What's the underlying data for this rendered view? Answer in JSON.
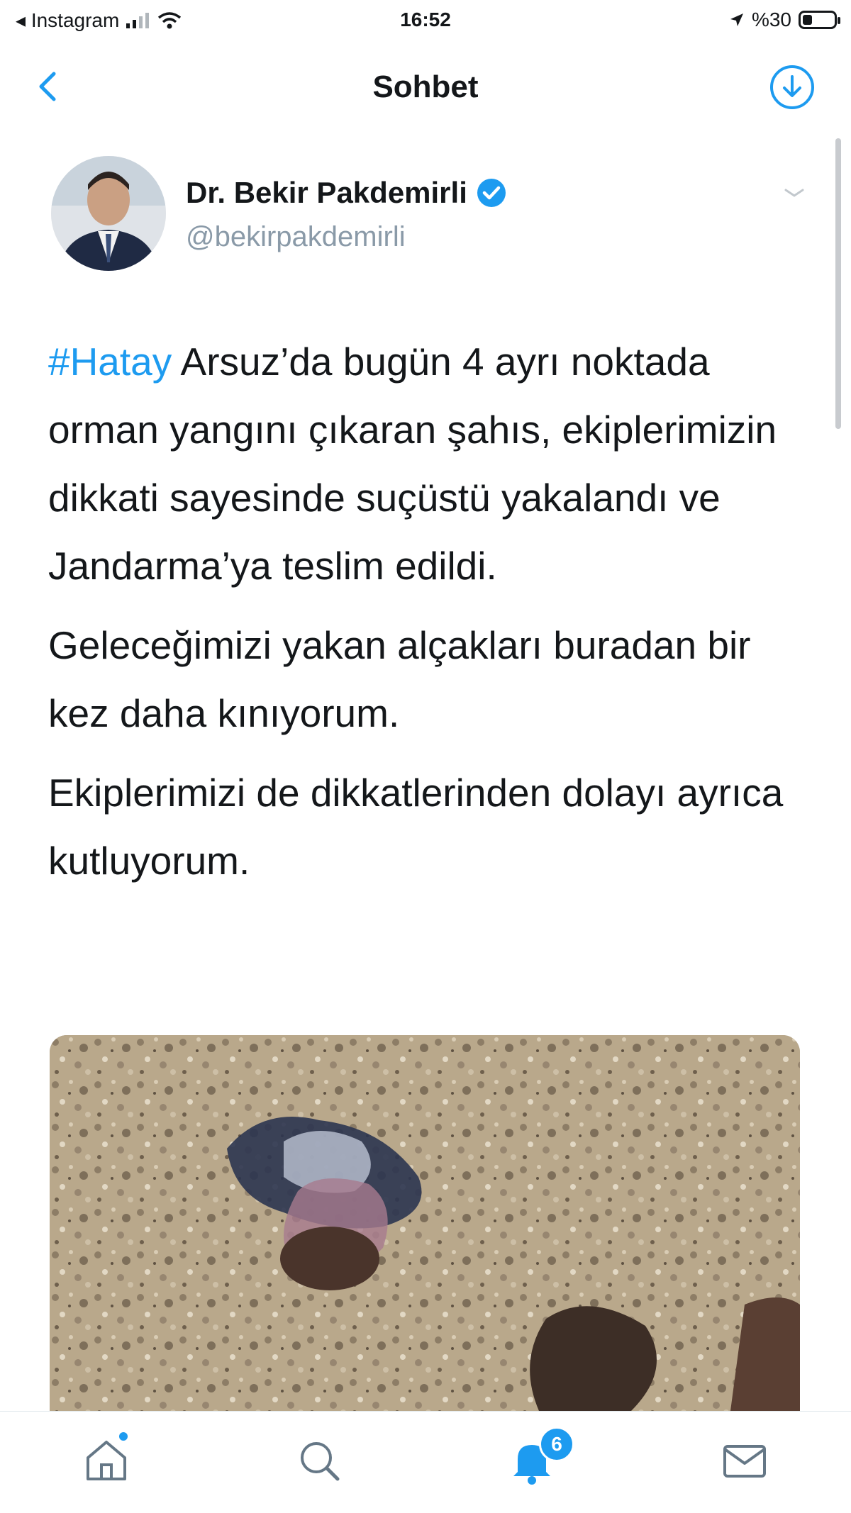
{
  "status_bar": {
    "carrier": "◂ Instagram",
    "time": "16:52",
    "battery_percent": "%30",
    "battery_level": 0.3
  },
  "nav": {
    "title": "Sohbet"
  },
  "tweet": {
    "author_name": "Dr. Bekir Pakdemirli",
    "author_handle": "@bekirpakdemirli",
    "hashtag": "#Hatay",
    "paragraph1_rest": " Arsuz’da bugün 4 ayrı noktada orman yangını çıkaran şahıs, ekiplerimizin dikkati sayesinde suçüstü yakalandı ve Jandarma’ya teslim edildi.",
    "paragraph2": "Geleceğimizi yakan alçakları buradan bir kez daha kınıyorum.",
    "paragraph3": "Ekiplerimizi de dikkatlerinden dolayı ayrıca kutluyorum."
  },
  "tab_bar": {
    "notification_count": "6"
  },
  "icons": {
    "back": "back-chevron-icon",
    "download": "download-icon",
    "verified": "verified-badge-icon",
    "more": "more-icon",
    "home": "home-icon",
    "search": "search-icon",
    "notifications": "bell-icon",
    "messages": "mail-icon"
  },
  "colors": {
    "accent": "#1d9bf0",
    "text": "#14171a",
    "secondary_text": "#8a9aa8"
  }
}
